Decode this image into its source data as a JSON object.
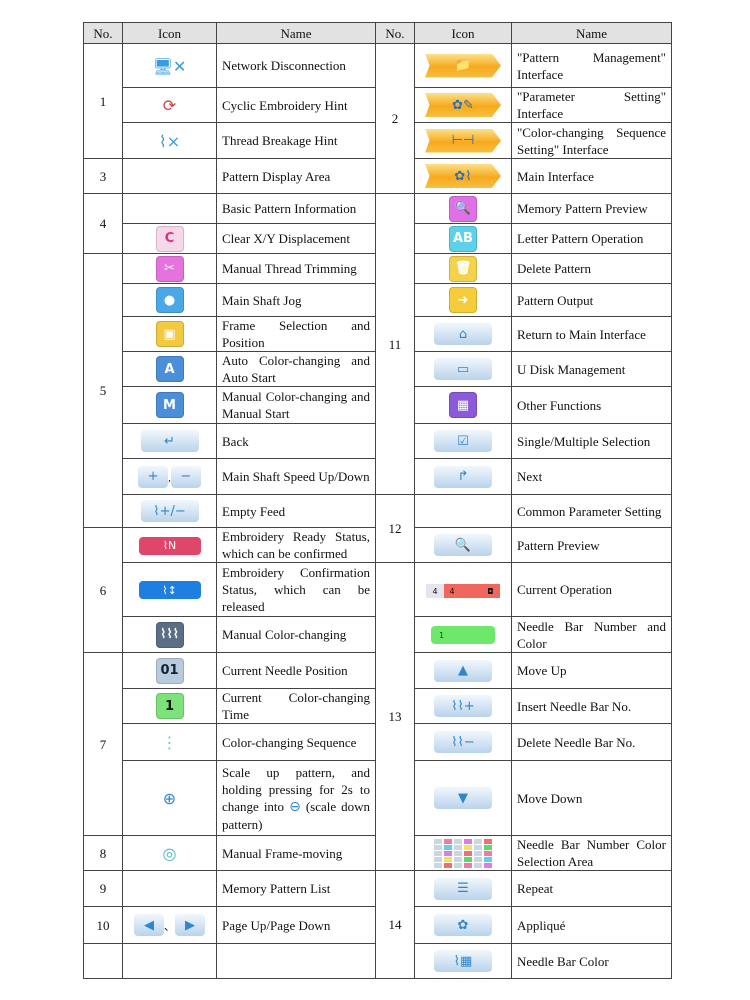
{
  "header": {
    "no": "No.",
    "icon": "Icon",
    "name": "Name"
  },
  "rows": [
    {
      "left": {
        "no": "1",
        "span": 3,
        "icon": {
          "name": "network-disconnection-icon",
          "kind": "bare",
          "color": "#3a9be0"
        },
        "name": "Network Disconnection"
      },
      "right": {
        "no": "2",
        "span": 4,
        "icon": {
          "name": "pattern-management-icon",
          "kind": "arrow"
        },
        "name": "\"Pattern Management\" Interface"
      }
    },
    {
      "left": {
        "icon": {
          "name": "cyclic-embroidery-icon",
          "kind": "bare",
          "color": "#d63b3b"
        },
        "name": "Cyclic Embroidery Hint"
      },
      "right": {
        "icon": {
          "name": "parameter-setting-icon",
          "kind": "arrow"
        },
        "name": "\"Parameter Setting\" Interface"
      }
    },
    {
      "left": {
        "icon": {
          "name": "thread-breakage-icon",
          "kind": "bare",
          "color": "#3a9be0"
        },
        "name": "Thread Breakage Hint"
      },
      "right": {
        "icon": {
          "name": "color-sequence-setting-icon",
          "kind": "arrow"
        },
        "name": "\"Color-changing Sequence Setting\" Interface"
      }
    },
    {
      "left": {
        "no": "3",
        "span": 1,
        "name": "Pattern Display Area"
      },
      "right": {
        "icon": {
          "name": "main-interface-icon",
          "kind": "arrow"
        },
        "name": "Main Interface"
      }
    },
    {
      "left": {
        "no": "4",
        "span": 2,
        "name": "Basic Pattern Information"
      },
      "right": {
        "no": "11",
        "span": 9,
        "icon": {
          "name": "memory-pattern-preview-icon",
          "kind": "tile",
          "color": "#e070e6"
        },
        "name": "Memory Pattern Preview"
      }
    },
    {
      "left": {
        "icon": {
          "name": "clear-displacement-icon",
          "kind": "tile",
          "color": "#f6d8ea",
          "fg": "#e0307a"
        },
        "name": "Clear X/Y Displacement"
      },
      "right": {
        "icon": {
          "name": "letter-pattern-icon",
          "kind": "tile",
          "color": "#5fd0ec"
        },
        "name": "Letter Pattern Operation"
      }
    },
    {
      "left": {
        "no": "5",
        "span": 8,
        "icon": {
          "name": "scissors-icon",
          "kind": "tile",
          "color": "#e672de"
        },
        "name": "Manual Thread Trimming"
      },
      "right": {
        "icon": {
          "name": "delete-pattern-icon",
          "kind": "tile",
          "color": "#f3d24c"
        },
        "name": "Delete Pattern"
      }
    },
    {
      "left": {
        "icon": {
          "name": "main-shaft-jog-icon",
          "kind": "tile",
          "color": "#4aa8e8"
        },
        "name": "Main Shaft Jog"
      },
      "right": {
        "icon": {
          "name": "pattern-output-icon",
          "kind": "tile",
          "color": "#f5cd3a"
        },
        "name": "Pattern Output"
      }
    },
    {
      "left": {
        "icon": {
          "name": "frame-selection-icon",
          "kind": "tile",
          "color": "#f3c940"
        },
        "name": "Frame Selection and Position"
      },
      "right": {
        "icon": {
          "name": "home-icon",
          "kind": "btn"
        },
        "name": "Return to Main Interface"
      }
    },
    {
      "left": {
        "icon": {
          "name": "auto-color-change-icon",
          "kind": "tile",
          "color": "#4a8fd8",
          "label": "A"
        },
        "name": "Auto Color-changing and Auto Start"
      },
      "right": {
        "icon": {
          "name": "usb-disk-icon",
          "kind": "btn"
        },
        "name": "U Disk Management"
      }
    },
    {
      "left": {
        "icon": {
          "name": "manual-color-change-icon",
          "kind": "tile",
          "color": "#4a8fd8",
          "label": "M"
        },
        "name": "Manual Color-changing and Manual Start"
      },
      "right": {
        "icon": {
          "name": "other-functions-icon",
          "kind": "tile",
          "color": "#8a5ad8"
        },
        "name": "Other Functions"
      }
    },
    {
      "left": {
        "icon": {
          "name": "back-icon",
          "kind": "btn"
        },
        "name": "Back"
      },
      "right": {
        "icon": {
          "name": "selection-icon",
          "kind": "btn"
        },
        "name": "Single/Multiple Selection"
      }
    },
    {
      "left": {
        "icon": {
          "name": "speed-up-down-icon",
          "kind": "pair",
          "a": "plus-icon",
          "b": "minus-icon",
          "sep": ","
        },
        "name": "Main Shaft Speed Up/Down"
      },
      "right": {
        "icon": {
          "name": "next-icon",
          "kind": "btn"
        },
        "name": "Next"
      }
    },
    {
      "left": {
        "icon": {
          "name": "empty-feed-icon",
          "kind": "btn"
        },
        "name": "Empty Feed"
      },
      "right": {
        "no": "12",
        "span": 2,
        "name": "Common Parameter Setting"
      }
    },
    {
      "left": {
        "no": "6",
        "span": 3,
        "icon": {
          "name": "embroidery-ready-icon",
          "kind": "pill",
          "color": "#e0466a"
        },
        "name": "Embroidery Ready Status, which can be confirmed"
      },
      "right": {
        "icon": {
          "name": "pattern-preview-icon",
          "kind": "btn"
        },
        "name": "Pattern Preview"
      }
    },
    {
      "left": {
        "icon": {
          "name": "embroidery-confirmation-icon",
          "kind": "pill",
          "color": "#1f7fe0"
        },
        "name": "Embroidery Confirmation Status, which can be released"
      },
      "right": {
        "no": "13",
        "span": 7,
        "icon": {
          "name": "current-operation-icon",
          "kind": "curop",
          "a": "4",
          "b": "4"
        },
        "name": "Current Operation"
      }
    },
    {
      "left": {
        "icon": {
          "name": "manual-color-changing-icon",
          "kind": "tile",
          "color": "#5a6f86"
        },
        "name": "Manual Color-changing"
      },
      "right": {
        "icon": {
          "name": "needle-bar-number-icon",
          "kind": "pill",
          "color": "#6ee86a",
          "fg": "#145214",
          "label": "1",
          "wide": true
        },
        "name": "Needle Bar Number and Color"
      }
    },
    {
      "left": {
        "no": "7",
        "span": 4,
        "icon": {
          "name": "current-needle-position-icon",
          "kind": "tile",
          "color": "#b8cbdc",
          "fg": "#123",
          "label": "01"
        },
        "name": "Current Needle Position"
      },
      "right": {
        "icon": {
          "name": "move-up-icon",
          "kind": "btn"
        },
        "name": "Move Up"
      }
    },
    {
      "left": {
        "icon": {
          "name": "color-changing-time-icon",
          "kind": "tile",
          "color": "#7ce27a",
          "fg": "#111",
          "label": "1"
        },
        "name": "Current Color-changing Time"
      },
      "right": {
        "icon": {
          "name": "insert-needle-bar-icon",
          "kind": "btn"
        },
        "name": "Insert Needle Bar No."
      }
    },
    {
      "left": {
        "icon": {
          "name": "color-changing-sequence-icon",
          "kind": "bare",
          "color": "#5bd0a0"
        },
        "name": "Color-changing Sequence"
      },
      "right": {
        "icon": {
          "name": "delete-needle-bar-icon",
          "kind": "btn"
        },
        "name": "Delete Needle Bar No."
      }
    },
    {
      "left": {
        "icon": {
          "name": "zoom-in-icon",
          "kind": "bare",
          "color": "#2f86cc"
        },
        "name": "Scale up pattern, and holding pressing for 2s to change into",
        "name2": "(scale down pattern)",
        "inline_icon": "zoom-out-icon"
      },
      "right": {
        "icon": {
          "name": "move-down-icon",
          "kind": "btn"
        },
        "name": "Move Down"
      }
    },
    {
      "left": {
        "no": "8",
        "span": 1,
        "icon": {
          "name": "frame-moving-icon",
          "kind": "bare",
          "color": "#3fb0c8"
        },
        "name": "Manual Frame-moving"
      },
      "right": {
        "icon": {
          "name": "color-selection-grid-icon",
          "kind": "grid"
        },
        "name": "Needle Bar Number Color Selection Area"
      }
    },
    {
      "left": {
        "no": "9",
        "span": 1,
        "name": "Memory Pattern List"
      },
      "right": {
        "no": "14",
        "span": 3,
        "icon": {
          "name": "repeat-icon",
          "kind": "btn"
        },
        "name": "Repeat"
      }
    },
    {
      "left": {
        "no": "10",
        "span": 1,
        "icon": {
          "name": "page-up-down-icon",
          "kind": "pair",
          "a": "page-up-icon",
          "b": "page-down-icon",
          "sep": "、"
        },
        "name": "Page Up/Page Down"
      },
      "right": {
        "icon": {
          "name": "applique-icon",
          "kind": "btn"
        },
        "name": "Appliqué"
      }
    },
    {
      "left": {
        "no": "",
        "span": 1,
        "name": ""
      },
      "right": {
        "icon": {
          "name": "needle-bar-color-icon",
          "kind": "btn"
        },
        "name": "Needle Bar Color"
      }
    }
  ]
}
